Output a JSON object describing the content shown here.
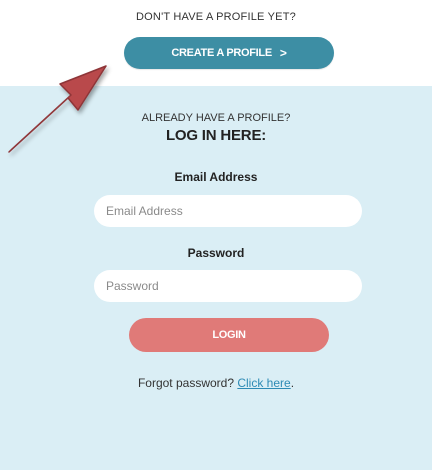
{
  "signup": {
    "prompt": "DON'T HAVE A PROFILE YET?",
    "button_label": "CREATE A PROFILE",
    "button_chevron": ">"
  },
  "login": {
    "already_text": "ALREADY HAVE A PROFILE?",
    "heading": "LOG IN HERE:",
    "email_label": "Email Address",
    "email_placeholder": "Email Address",
    "email_value": "",
    "password_label": "Password",
    "password_placeholder": "Password",
    "password_value": "",
    "button_label": "LOGIN",
    "forgot_text": "Forgot password?",
    "forgot_link": "Click here",
    "forgot_suffix": "."
  },
  "colors": {
    "create_button": "#3d8ea4",
    "login_button": "#e07a78",
    "panel_background": "#daeef5",
    "arrow": "#b94a4c",
    "link": "#2e8bb5"
  },
  "icons": {
    "annotation_arrow": "arrow-pointing-up-right-icon",
    "chevron": "chevron-right-icon"
  }
}
